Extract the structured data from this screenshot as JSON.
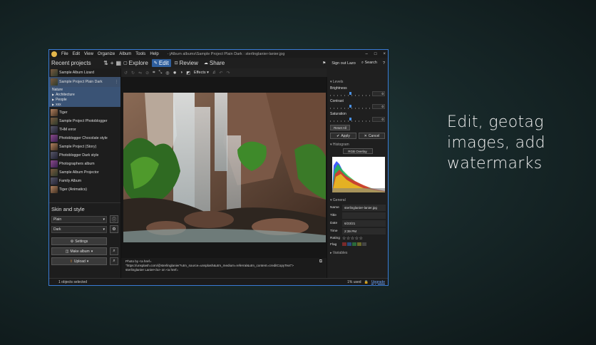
{
  "tagline": [
    "Edit, geotag",
    "images, add",
    "watermarks"
  ],
  "window": {
    "menu": [
      "File",
      "Edit",
      "View",
      "Organize",
      "Album",
      "Tools",
      "Help"
    ],
    "title": "- jAlbum albums\\Sample Project Plain Dark : sterlinglanier-lanier.jpg",
    "controls": [
      "–",
      "□",
      "×"
    ]
  },
  "toolbar": {
    "recent_label": "Recent projects",
    "tabs": [
      {
        "label": "Explore",
        "icon": "folder-icon"
      },
      {
        "label": "Edit",
        "icon": "pencil-icon"
      },
      {
        "label": "Review",
        "icon": "review-icon"
      },
      {
        "label": "Share",
        "icon": "cloud-icon"
      }
    ],
    "sign_out": "Sign out Lazo",
    "search": "Search"
  },
  "projects": [
    {
      "name": "Sample Album Lizard"
    },
    {
      "name": "Sample Project Plain Dark"
    },
    {
      "name": "Tiger"
    },
    {
      "name": "Sample Project Photoblogger"
    },
    {
      "name": "THM error"
    },
    {
      "name": "Photoblogger Chocolate style"
    },
    {
      "name": "Sample Project (Story)"
    },
    {
      "name": "Photoblogger Dark style"
    },
    {
      "name": "Photographers album"
    },
    {
      "name": "Sample Album Projector"
    },
    {
      "name": "Family Album"
    },
    {
      "name": "Tiger (Animatics)"
    }
  ],
  "subfolders": [
    "Nature",
    "Architecture",
    "People",
    "xxx"
  ],
  "skin": {
    "heading": "Skin and style",
    "skin_value": "Plain",
    "style_value": "Dark",
    "settings": "Settings",
    "make_album": "Make album",
    "upload": "Upload"
  },
  "edit_toolbar": {
    "effects": "Effects ▾"
  },
  "caption": {
    "line1": "Photo by <a href=",
    "line2": "\"https://unsplash.com/@sterlinglanier?utm_source=unsplash&utm_medium=referral&utm_content=creditCopyText\">",
    "line3": "sterlinglanier Lanier</a> on <a href="
  },
  "levels": {
    "section": "▾ Levels",
    "brightness": {
      "label": "Brightness",
      "value": "0",
      "level": 0.5
    },
    "contrast": {
      "label": "Contrast",
      "value": "0",
      "level": 0.5
    },
    "saturation": {
      "label": "Saturation",
      "value": "0",
      "level": 0.5
    },
    "reset": "Reset All",
    "apply": "Apply",
    "cancel": "Cancel"
  },
  "histogram": {
    "section": "▾ Histogram",
    "mode": "RGB Overlay"
  },
  "general": {
    "section": "▾ General",
    "name_key": "Name",
    "name": "sterlinglanier-lanier.jpg",
    "title_key": "Title",
    "title": "",
    "date_key": "Date",
    "date": "6/23/21",
    "time_key": "Time",
    "time": "2:39 PM",
    "rating_key": "Rating",
    "rating": "☆☆☆☆☆",
    "flag_key": "Flag",
    "flag_colors": [
      "#7a2a2a",
      "#2a4a7a",
      "#2a6a3a",
      "#6a6a2a",
      "#444444"
    ]
  },
  "variables_section": "▸ Variables",
  "status": {
    "selected": "1 objects selected",
    "usage": "1% used",
    "upgrade": "Upgrade"
  },
  "colors": {
    "accent": "#2f5f9e",
    "window_border": "#3a7bd5"
  }
}
